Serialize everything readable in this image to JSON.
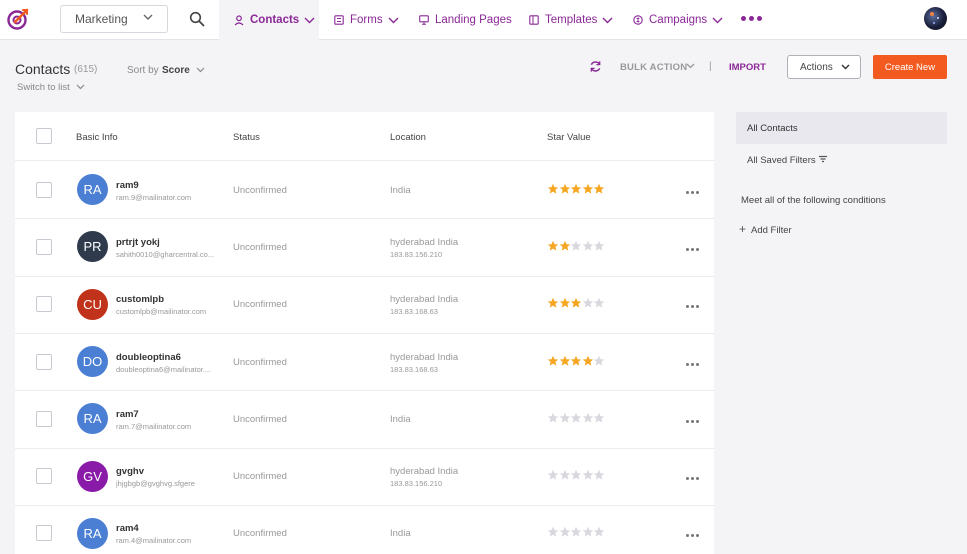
{
  "nav": {
    "workspace": "Marketing",
    "tabs": [
      {
        "label": "Contacts",
        "icon": "user-icon",
        "active": true
      },
      {
        "label": "Forms",
        "icon": "form-icon"
      },
      {
        "label": "Landing Pages",
        "icon": "monitor-icon"
      },
      {
        "label": "Templates",
        "icon": "template-icon"
      },
      {
        "label": "Campaigns",
        "icon": "campaign-icon"
      }
    ]
  },
  "header": {
    "title": "Contacts",
    "count": "(615)",
    "switch_list": "Switch to list",
    "sort_label": "Sort by",
    "sort_value": "Score",
    "bulk_action": "BULK ACTION",
    "separator": "|",
    "import": "IMPORT",
    "actions": "Actions",
    "create_new": "Create New"
  },
  "table": {
    "headers": {
      "basic_info": "Basic Info",
      "status": "Status",
      "location": "Location",
      "star_value": "Star Value"
    },
    "rows": [
      {
        "initials": "RA",
        "color": "#4a7fd4",
        "name": "ram9",
        "email": "ram.9@mailinator.com",
        "status": "Unconfirmed",
        "location": "India",
        "ip": "",
        "stars": 5
      },
      {
        "initials": "PR",
        "color": "#2f3a4d",
        "name": "prtrjt yokj",
        "email": "sahith0010@gharcentral.co...",
        "status": "Unconfirmed",
        "location": "hyderabad India",
        "ip": "183.83.156.210",
        "stars": 2
      },
      {
        "initials": "CU",
        "color": "#c0321a",
        "name": "customlpb",
        "email": "customlpb@mailinator.com",
        "status": "Unconfirmed",
        "location": "hyderabad India",
        "ip": "183.83.168.63",
        "stars": 3
      },
      {
        "initials": "DO",
        "color": "#4a7fd4",
        "name": "doubleoptina6",
        "email": "doubleoptina6@mailinator....",
        "status": "Unconfirmed",
        "location": "hyderabad India",
        "ip": "183.83.168.63",
        "stars": 4
      },
      {
        "initials": "RA",
        "color": "#4a7fd4",
        "name": "ram7",
        "email": "ram.7@mailinator.com",
        "status": "Unconfirmed",
        "location": "India",
        "ip": "",
        "stars": 0
      },
      {
        "initials": "GV",
        "color": "#8a1aa8",
        "name": "gvghv",
        "email": "jhjgbgb@gvghvg.sfgere",
        "status": "Unconfirmed",
        "location": "hyderabad India",
        "ip": "183.83.156.210",
        "stars": 0
      },
      {
        "initials": "RA",
        "color": "#4a7fd4",
        "name": "ram4",
        "email": "ram.4@mailinator.com",
        "status": "Unconfirmed",
        "location": "India",
        "ip": "",
        "stars": 0
      }
    ]
  },
  "panel": {
    "all_contacts": "All Contacts",
    "all_saved_filters": "All Saved Filters",
    "conditions": "Meet all of the following conditions",
    "add_filter": "Add Filter"
  },
  "colors": {
    "accent": "#8a2896",
    "primary_button": "#f25a1f",
    "star_filled": "#f5a623",
    "star_empty": "#d8d8de"
  }
}
